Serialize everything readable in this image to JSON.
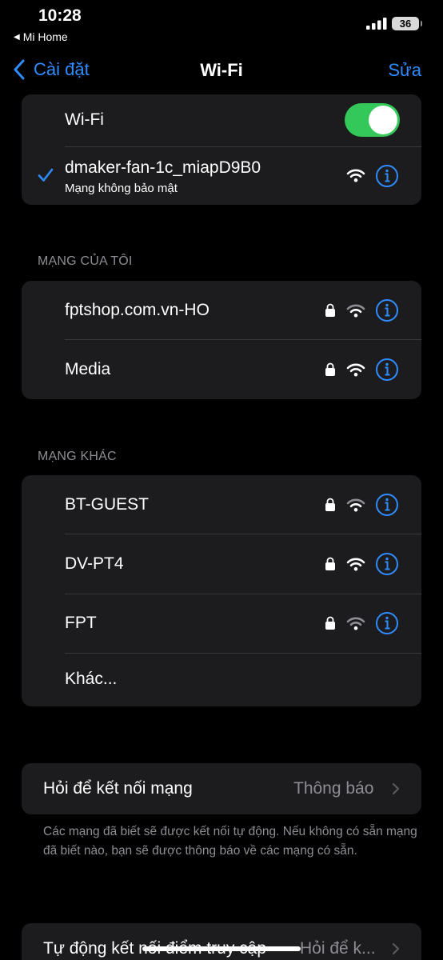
{
  "status": {
    "time": "10:28",
    "back_app": "Mi Home",
    "battery": "36"
  },
  "nav": {
    "back_label": "Cài đặt",
    "title": "Wi-Fi",
    "edit_label": "Sửa"
  },
  "wifi_main": {
    "toggle_label": "Wi-Fi",
    "toggle_on": true,
    "connected_name": "dmaker-fan-1c_miapD9B0",
    "connected_sub": "Mạng không bảo mật"
  },
  "my_networks": {
    "header": "MẠNG CỦA TÔI",
    "items": [
      {
        "name": "fptshop.com.vn-HO",
        "locked": true
      },
      {
        "name": "Media",
        "locked": true
      }
    ]
  },
  "other_networks": {
    "header": "MẠNG KHÁC",
    "items": [
      {
        "name": "BT-GUEST",
        "locked": true
      },
      {
        "name": "DV-PT4",
        "locked": true
      },
      {
        "name": "FPT",
        "locked": true
      }
    ],
    "other_label": "Khác..."
  },
  "ask_join": {
    "label": "Hỏi để kết nối mạng",
    "value": "Thông báo",
    "footer": "Các mạng đã biết sẽ được kết nối tự động. Nếu không có sẵn mạng đã biết nào, bạn sẽ được thông báo về các mạng có sẵn."
  },
  "auto_join_hotspot": {
    "label": "Tự động kết nối điểm truy cập",
    "value": "Hỏi để k..."
  },
  "colors": {
    "accent": "#2f8cff",
    "toggle_on": "#34c759",
    "cell_bg": "#1c1c1e",
    "secondary_text": "#8d8d93"
  }
}
